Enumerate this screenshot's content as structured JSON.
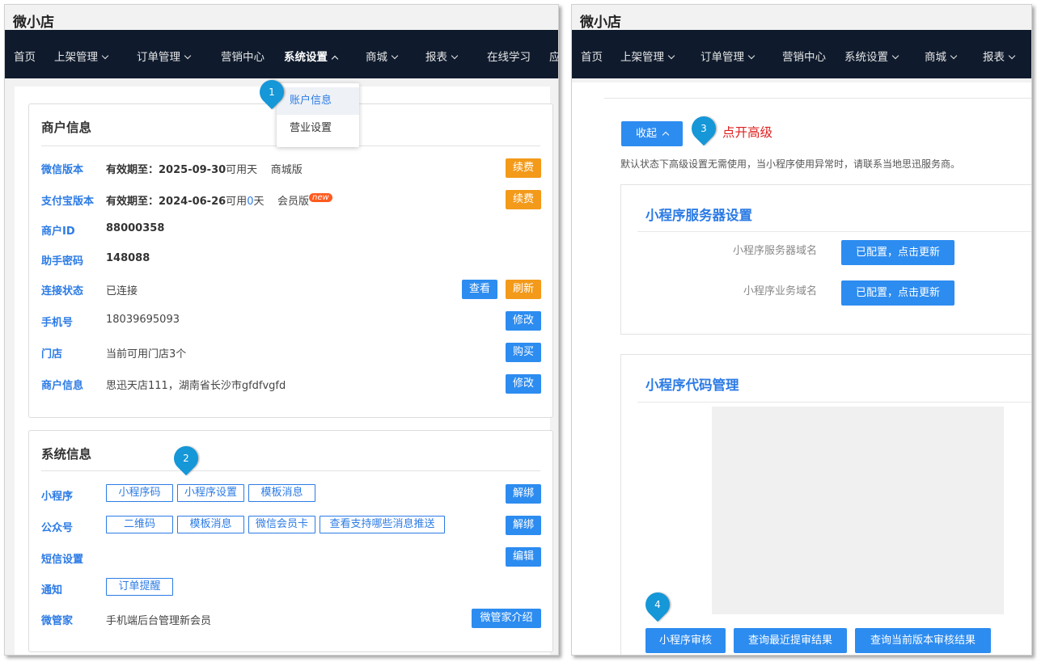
{
  "app_title": "微小店",
  "nav_left": [
    {
      "label": "首页",
      "chevron": ""
    },
    {
      "label": "上架管理",
      "chevron": "down"
    },
    {
      "label": "订单管理",
      "chevron": "down"
    },
    {
      "label": "营销中心",
      "chevron": ""
    },
    {
      "label": "系统设置",
      "chevron": "up"
    },
    {
      "label": "商城",
      "chevron": "down"
    },
    {
      "label": "报表",
      "chevron": "down"
    },
    {
      "label": "在线学习",
      "chevron": ""
    },
    {
      "label": "应",
      "chevron": ""
    }
  ],
  "nav_right": [
    {
      "label": "首页",
      "chevron": ""
    },
    {
      "label": "上架管理",
      "chevron": "down"
    },
    {
      "label": "订单管理",
      "chevron": "down"
    },
    {
      "label": "营销中心",
      "chevron": ""
    },
    {
      "label": "系统设置",
      "chevron": "down"
    },
    {
      "label": "商城",
      "chevron": "down"
    },
    {
      "label": "报表",
      "chevron": "down"
    }
  ],
  "dropdown": {
    "items": [
      "账户信息",
      "营业设置"
    ]
  },
  "markers": [
    "1",
    "2",
    "3",
    "4"
  ],
  "merchant": {
    "title": "商户信息",
    "wechat_label": "微信版本",
    "wechat_expire_prefix": "有效期至：",
    "wechat_expire_date": "2025-09-30",
    "wechat_available": "可用天",
    "wechat_edition": "商城版",
    "wechat_btn": "续费",
    "alipay_label": "支付宝版本",
    "alipay_expire_prefix": "有效期至：",
    "alipay_expire_date": "2024-06-26",
    "alipay_avail_prefix": "可用",
    "alipay_days": "0",
    "alipay_avail_suffix": "天",
    "alipay_edition": "会员版",
    "alipay_badge": "new",
    "alipay_btn": "续费",
    "id_label": "商户ID",
    "id_value": "88000358",
    "pwd_label": "助手密码",
    "pwd_value": "148088",
    "conn_label": "连接状态",
    "conn_value": "已连接",
    "conn_view_btn": "查看",
    "conn_refresh_btn": "刷新",
    "phone_label": "手机号",
    "phone_value": "18039695093",
    "phone_btn": "修改",
    "store_label": "门店",
    "store_value": "当前可用门店3个",
    "store_btn": "购买",
    "info_label": "商户信息",
    "info_value": "思迅天店111，湖南省长沙市gfdfvgfd",
    "info_btn": "修改"
  },
  "system": {
    "title": "系统信息",
    "mini_label": "小程序",
    "mini_btns": [
      "小程序码",
      "小程序设置",
      "模板消息"
    ],
    "mini_unbind": "解绑",
    "mp_label": "公众号",
    "mp_btns": [
      "二维码",
      "模板消息",
      "微信会员卡",
      "查看支持哪些消息推送"
    ],
    "mp_unbind": "解绑",
    "sms_label": "短信设置",
    "sms_btn": "编辑",
    "notice_label": "通知",
    "notice_btn": "订单提醒",
    "butler_label": "微管家",
    "butler_value": "手机端后台管理新会员",
    "butler_btn": "微管家介绍"
  },
  "right": {
    "collapse_btn": "收起",
    "annotation": "点开高级",
    "annotation_color": "#e02020",
    "notice": "默认状态下高级设置无需使用，当小程序使用异常时，请联系当地思迅服务商。",
    "server_title": "小程序服务器设置",
    "server_domain_label": "小程序服务器域名",
    "server_domain_btn": "已配置，点击更新",
    "biz_domain_label": "小程序业务域名",
    "biz_domain_btn": "已配置，点击更新",
    "code_title": "小程序代码管理",
    "audit_btn": "小程序审核",
    "recent_btn": "查询最近提审结果",
    "current_btn": "查询当前版本审核结果"
  },
  "colors": {
    "nav_bg": "#0f1b2d",
    "accent_blue": "#2d8cf0",
    "accent_orange": "#f39a1a",
    "marker": "#1597d8"
  }
}
